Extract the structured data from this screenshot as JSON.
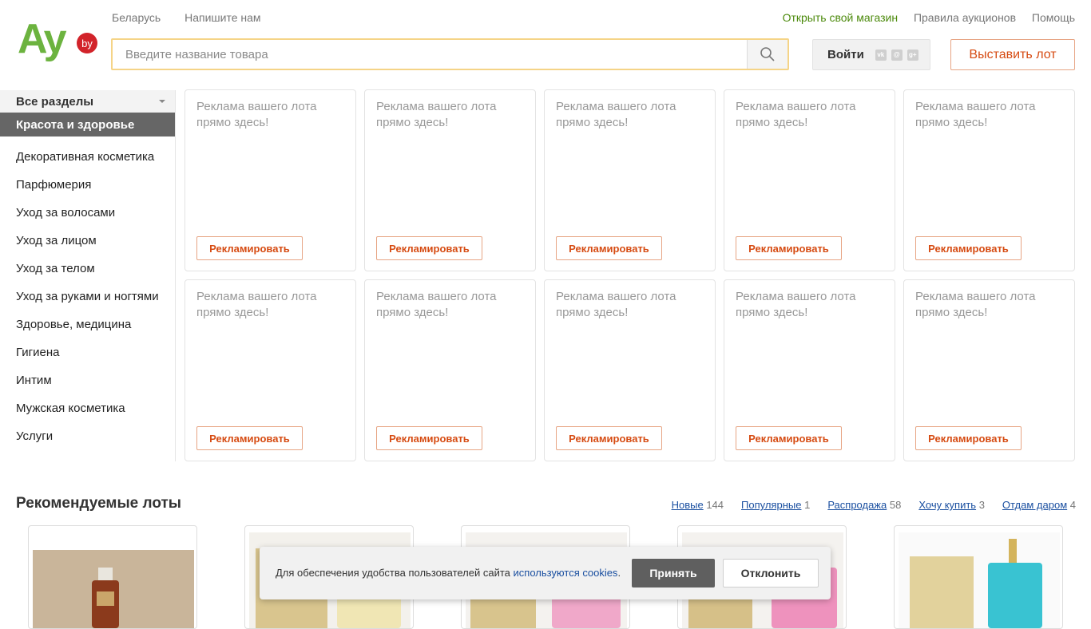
{
  "header": {
    "logo_text": "Ay",
    "logo_badge": "by",
    "region": "Беларусь",
    "write_us": "Напишите нам",
    "open_shop": "Открыть свой магазин",
    "auction_rules": "Правила аукционов",
    "help": "Помощь",
    "search_placeholder": "Введите название товара",
    "login": "Войти",
    "put_lot": "Выставить лот",
    "colors": {
      "brand_green": "#6cb33f",
      "accent_orange": "#d64b12"
    }
  },
  "sidebar": {
    "all_sections": "Все разделы",
    "active": "Красота и здоровье",
    "items": [
      "Декоративная косметика",
      "Парфюмерия",
      "Уход за волосами",
      "Уход за лицом",
      "Уход за телом",
      "Уход за руками и ногтями",
      "Здоровье, медицина",
      "Гигиена",
      "Интим",
      "Мужская косметика",
      "Услуги"
    ]
  },
  "ads": {
    "text": "Реклама вашего лота прямо здесь!",
    "button": "Рекламировать"
  },
  "recommended": {
    "title": "Рекомендуемые лоты",
    "filters": [
      {
        "label": "Новые",
        "count": "144"
      },
      {
        "label": "Популярные",
        "count": "1"
      },
      {
        "label": "Распродажа",
        "count": "58"
      },
      {
        "label": "Хочу купить",
        "count": "3"
      },
      {
        "label": "Отдам даром",
        "count": "4"
      }
    ]
  },
  "cookie": {
    "text": "Для обеспечения удобства пользователей сайта ",
    "link": "используются cookies",
    "suffix": ".",
    "accept": "Принять",
    "decline": "Отклонить"
  }
}
